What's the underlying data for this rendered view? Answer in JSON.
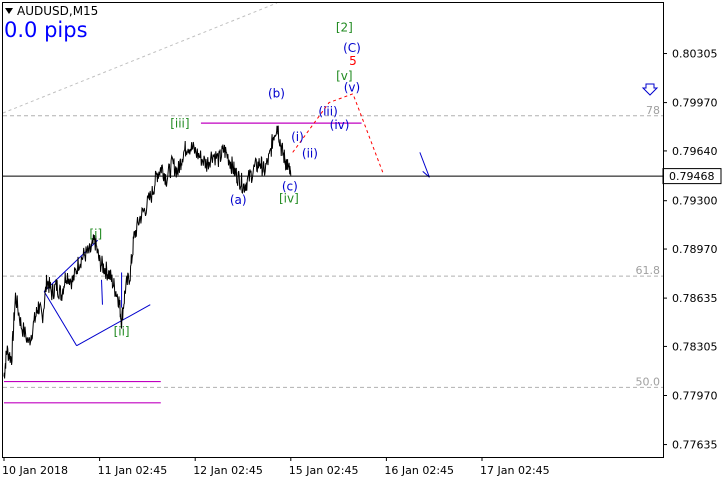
{
  "chart_header": {
    "symbol_timeframe": "AUDUSD,M15",
    "pips_text": "0.0 pips"
  },
  "chart_data": {
    "type": "line",
    "title": "AUDUSD,M15",
    "series": [
      {
        "x": [
          "10 Jan 2018",
          "11 Jan 02:45",
          "12 Jan 02:45",
          "15 Jan 02:45",
          "16 Jan 02:45",
          "17 Jan 02:45"
        ],
        "points": [
          [
            0,
            0.781
          ],
          [
            0.03,
            0.7828
          ],
          [
            0.08,
            0.7822
          ],
          [
            0.12,
            0.7865
          ],
          [
            0.18,
            0.7845
          ],
          [
            0.26,
            0.7833
          ],
          [
            0.32,
            0.7848
          ],
          [
            0.36,
            0.7858
          ],
          [
            0.4,
            0.785
          ],
          [
            0.45,
            0.7876
          ],
          [
            0.5,
            0.7867
          ],
          [
            0.55,
            0.7872
          ],
          [
            0.6,
            0.7866
          ],
          [
            0.65,
            0.788
          ],
          [
            0.72,
            0.7875
          ],
          [
            0.78,
            0.7888
          ],
          [
            0.84,
            0.7893
          ],
          [
            0.9,
            0.7895
          ],
          [
            0.95,
            0.7903
          ],
          [
            1.0,
            0.7888
          ],
          [
            1.05,
            0.7884
          ],
          [
            1.1,
            0.788
          ],
          [
            1.15,
            0.7872
          ],
          [
            1.2,
            0.7863
          ],
          [
            1.23,
            0.7848
          ],
          [
            1.27,
            0.787
          ],
          [
            1.32,
            0.788
          ],
          [
            1.36,
            0.7905
          ],
          [
            1.42,
            0.7918
          ],
          [
            1.48,
            0.7925
          ],
          [
            1.55,
            0.7935
          ],
          [
            1.6,
            0.7948
          ],
          [
            1.65,
            0.7953
          ],
          [
            1.7,
            0.7945
          ],
          [
            1.76,
            0.7955
          ],
          [
            1.82,
            0.795
          ],
          [
            1.87,
            0.7962
          ],
          [
            1.92,
            0.7968
          ],
          [
            1.98,
            0.7965
          ],
          [
            2.05,
            0.796
          ],
          [
            2.12,
            0.7955
          ],
          [
            2.18,
            0.7962
          ],
          [
            2.25,
            0.7958
          ],
          [
            2.3,
            0.7965
          ],
          [
            2.36,
            0.7958
          ],
          [
            2.41,
            0.795
          ],
          [
            2.46,
            0.7945
          ],
          [
            2.51,
            0.794
          ],
          [
            2.56,
            0.7945
          ],
          [
            2.62,
            0.7952
          ],
          [
            2.68,
            0.7956
          ],
          [
            2.72,
            0.795
          ],
          [
            2.78,
            0.796
          ],
          [
            2.82,
            0.7975
          ],
          [
            2.86,
            0.7982
          ],
          [
            2.9,
            0.7966
          ],
          [
            2.94,
            0.7958
          ],
          [
            2.97,
            0.7953
          ],
          [
            3.0,
            0.7947
          ]
        ]
      }
    ],
    "y_ticks": [
      "0.80305",
      "0.79970",
      "0.79640",
      "0.79300",
      "0.78970",
      "0.78635",
      "0.78305",
      "0.77970",
      "0.77635"
    ],
    "ylim": [
      0.7755,
      0.8065
    ],
    "current_price": "0.79468",
    "fib_levels": [
      {
        "label": "78",
        "value": 0.7988
      },
      {
        "label": "61.8",
        "value": 0.78785
      },
      {
        "label": "50.0",
        "value": 0.78025
      }
    ],
    "wave_labels": [
      {
        "text": "[i]",
        "color": "#228b22",
        "x": 0.96,
        "y": 0.7907
      },
      {
        "text": "[ii]",
        "color": "#228b22",
        "x": 1.23,
        "y": 0.78405
      },
      {
        "text": "[iii]",
        "color": "#228b22",
        "x": 1.84,
        "y": 0.79825
      },
      {
        "text": "[iv]",
        "color": "#228b22",
        "x": 2.98,
        "y": 0.7931
      },
      {
        "text": "[v]",
        "color": "#228b22",
        "x": 3.56,
        "y": 0.80148
      },
      {
        "text": "[2]",
        "color": "#228b22",
        "x": 3.56,
        "y": 0.8048
      },
      {
        "text": "(a)",
        "color": "#0000cd",
        "x": 2.45,
        "y": 0.793
      },
      {
        "text": "(b)",
        "color": "#0000cd",
        "x": 2.85,
        "y": 0.8003
      },
      {
        "text": "(c)",
        "color": "#0000cd",
        "x": 2.99,
        "y": 0.79392
      },
      {
        "text": "(i)",
        "color": "#0000cd",
        "x": 3.07,
        "y": 0.7973
      },
      {
        "text": "(ii)",
        "color": "#0000cd",
        "x": 3.2,
        "y": 0.7962
      },
      {
        "text": "(iii)",
        "color": "#0000cd",
        "x": 3.39,
        "y": 0.79907
      },
      {
        "text": "(iv)",
        "color": "#0000cd",
        "x": 3.51,
        "y": 0.79815
      },
      {
        "text": "(v)",
        "color": "#0000cd",
        "x": 3.64,
        "y": 0.8007
      },
      {
        "text": "(C)",
        "color": "#0000cd",
        "x": 3.64,
        "y": 0.8034
      },
      {
        "text": "5",
        "color": "#ff0000",
        "x": 3.65,
        "y": 0.80252
      }
    ],
    "horizontal_lines": [
      {
        "value": 0.7983,
        "x_from": 2.06,
        "x_to": 3.74,
        "color": "#c000c0"
      },
      {
        "value": 0.78065,
        "x_from": 0.0,
        "x_to": 1.64,
        "color": "#c000c0"
      },
      {
        "value": 0.7792,
        "x_from": 0.0,
        "x_to": 1.64,
        "color": "#c000c0"
      }
    ],
    "legend": "none",
    "grid": false
  },
  "colors": {
    "price_line": "#000000",
    "axis": "#000000",
    "fib_line": "#b0b0b0",
    "channel": "#0000cd",
    "resistance": "#c000c0",
    "projection": "#ff0000",
    "current_price_bg": "#ffffff"
  }
}
